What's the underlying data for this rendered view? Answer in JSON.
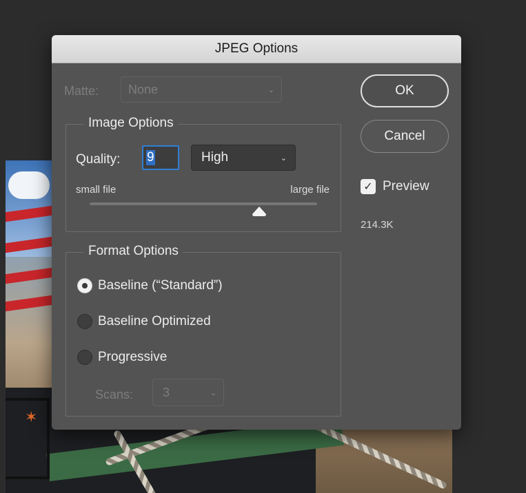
{
  "dialog": {
    "title": "JPEG Options",
    "matte": {
      "label": "Matte:",
      "value": "None",
      "enabled": false
    },
    "image_options": {
      "title": "Image Options",
      "quality_label": "Quality:",
      "quality_value": "9",
      "quality_preset": "High",
      "slider_min_label": "small file",
      "slider_max_label": "large file",
      "slider_value": 9,
      "slider_range": [
        0,
        12
      ]
    },
    "format_options": {
      "title": "Format Options",
      "options": [
        {
          "label": "Baseline (“Standard”)",
          "selected": true
        },
        {
          "label": "Baseline Optimized",
          "selected": false
        },
        {
          "label": "Progressive",
          "selected": false
        }
      ],
      "scans_label": "Scans:",
      "scans_value": "3",
      "scans_enabled": false
    },
    "buttons": {
      "ok": "OK",
      "cancel": "Cancel"
    },
    "preview": {
      "label": "Preview",
      "checked": true
    },
    "file_size": "214.3K"
  },
  "colors": {
    "dialog_bg": "#535353",
    "focus_ring": "#2f7fd6",
    "workspace_bg": "#2c2c2c"
  },
  "icons": {
    "dropdown": "chevron-down-icon",
    "checkbox": "checkmark-icon",
    "slider_thumb": "triangle-thumb-icon"
  }
}
